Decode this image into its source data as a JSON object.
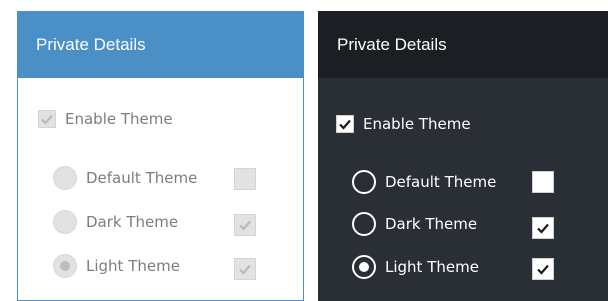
{
  "light_panel": {
    "header": "Private Details",
    "enable_theme": {
      "label": "Enable Theme",
      "checked": true
    },
    "themes": [
      {
        "label": "Default Theme",
        "selected": false,
        "checked": false
      },
      {
        "label": "Dark Theme",
        "selected": false,
        "checked": true
      },
      {
        "label": "Light Theme",
        "selected": true,
        "checked": true
      }
    ]
  },
  "dark_panel": {
    "header": "Private Details",
    "enable_theme": {
      "label": "Enable Theme",
      "checked": true
    },
    "themes": [
      {
        "label": "Default Theme",
        "selected": false,
        "checked": false
      },
      {
        "label": "Dark Theme",
        "selected": false,
        "checked": true
      },
      {
        "label": "Light Theme",
        "selected": true,
        "checked": true
      }
    ]
  },
  "colors": {
    "light_header_bg": "#4a8fc6",
    "dark_header_bg": "#1b1f24",
    "dark_panel_bg": "#2a2f35"
  }
}
